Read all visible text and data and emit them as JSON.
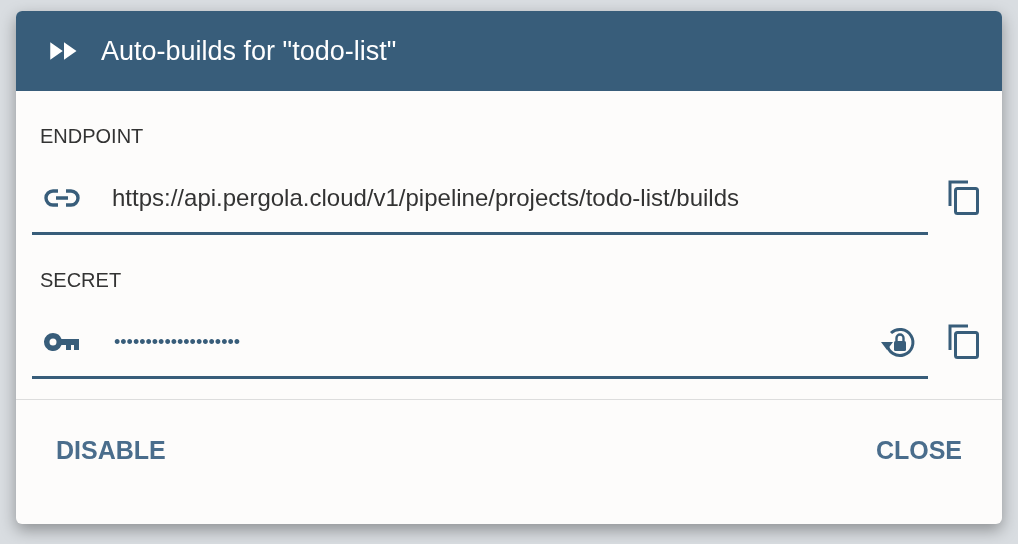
{
  "dialog": {
    "title": "Auto-builds for \"todo-list\""
  },
  "fields": [
    {
      "kind": "endpoint",
      "label": "ENDPOINT",
      "value": "https://api.pergola.cloud/v1/pipeline/projects/todo-list/builds"
    },
    {
      "kind": "secret",
      "label": "SECRET",
      "value": "••••••••••••••••••••"
    }
  ],
  "actions": [
    {
      "label": "DISABLE"
    },
    {
      "label": "CLOSE"
    }
  ]
}
